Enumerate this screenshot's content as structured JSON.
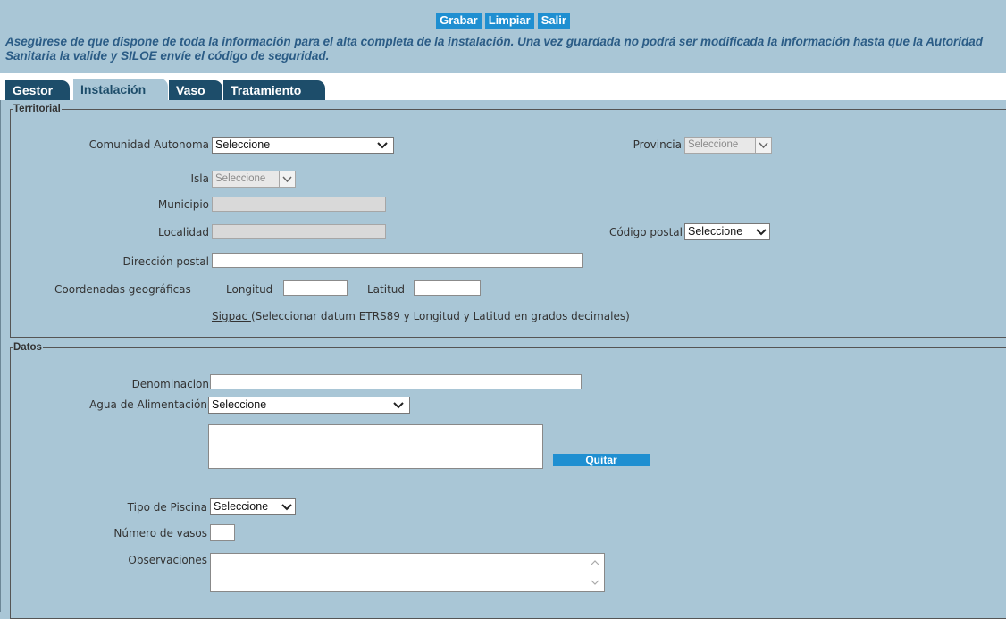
{
  "toolbar": {
    "grabar": "Grabar",
    "limpiar": "Limpiar",
    "salir": "Salir"
  },
  "notice": "Asegúrese de que dispone de toda la información para el alta completa de la instalación. Una vez guardada no podrá ser modificada la información hasta que la Autoridad Sanitaria la valide y SILOE envíe el código de seguridad.",
  "tabs": [
    {
      "label": "Gestor"
    },
    {
      "label": "Instalación"
    },
    {
      "label": "Vaso"
    },
    {
      "label": "Tratamiento"
    }
  ],
  "territorial": {
    "legend": "Territorial",
    "comunidad_label": "Comunidad Autonoma",
    "comunidad_value": "Seleccione",
    "provincia_label": "Provincia",
    "provincia_value": "Seleccione",
    "isla_label": "Isla",
    "isla_value": "Seleccione",
    "municipio_label": "Municipio",
    "localidad_label": "Localidad",
    "codigo_postal_label": "Código postal",
    "codigo_postal_value": "Seleccione",
    "direccion_label": "Dirección postal",
    "coordenadas_label": "Coordenadas geográficas",
    "longitud_label": "Longitud",
    "latitud_label": "Latitud",
    "sigpac_link": "Sigpac ",
    "sigpac_note": "(Seleccionar datum ETRS89 y Longitud y Latitud en grados decimales)"
  },
  "datos": {
    "legend": "Datos",
    "denominacion_label": "Denominacion",
    "agua_label": "Agua de Alimentación",
    "agua_value": "Seleccione",
    "quitar_button": "Quitar",
    "tipo_label": "Tipo de Piscina",
    "tipo_value": "Seleccione",
    "num_vasos_label": "Número de vasos",
    "observaciones_label": "Observaciones"
  }
}
